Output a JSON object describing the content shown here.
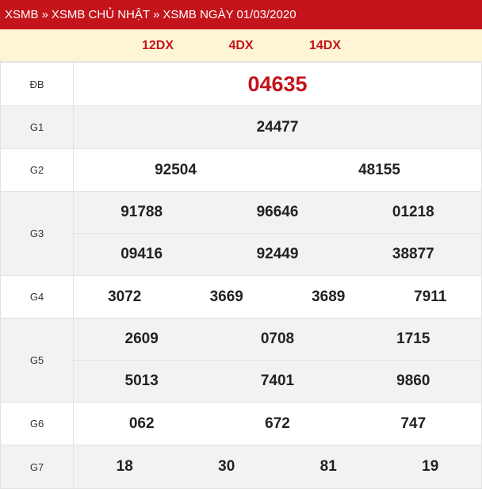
{
  "breadcrumb": {
    "items": [
      "XSMB",
      "XSMB CHỦ NHẬT",
      "XSMB NGÀY 01/03/2020"
    ],
    "separator": "»"
  },
  "codes": [
    "12DX",
    "4DX",
    "14DX"
  ],
  "prizes": {
    "db": {
      "label": "ĐB",
      "numbers": [
        "04635"
      ]
    },
    "g1": {
      "label": "G1",
      "numbers": [
        "24477"
      ]
    },
    "g2": {
      "label": "G2",
      "numbers": [
        "92504",
        "48155"
      ]
    },
    "g3": {
      "label": "G3",
      "rows": [
        [
          "91788",
          "96646",
          "01218"
        ],
        [
          "09416",
          "92449",
          "38877"
        ]
      ]
    },
    "g4": {
      "label": "G4",
      "numbers": [
        "3072",
        "3669",
        "3689",
        "7911"
      ]
    },
    "g5": {
      "label": "G5",
      "rows": [
        [
          "2609",
          "0708",
          "1715"
        ],
        [
          "5013",
          "7401",
          "9860"
        ]
      ]
    },
    "g6": {
      "label": "G6",
      "numbers": [
        "062",
        "672",
        "747"
      ]
    },
    "g7": {
      "label": "G7",
      "numbers": [
        "18",
        "30",
        "81",
        "19"
      ]
    }
  },
  "colors": {
    "accent": "#c4141b",
    "header_bg": "#c4141b",
    "codes_bg": "#fdf5d4",
    "shade": "#f2f2f2"
  }
}
